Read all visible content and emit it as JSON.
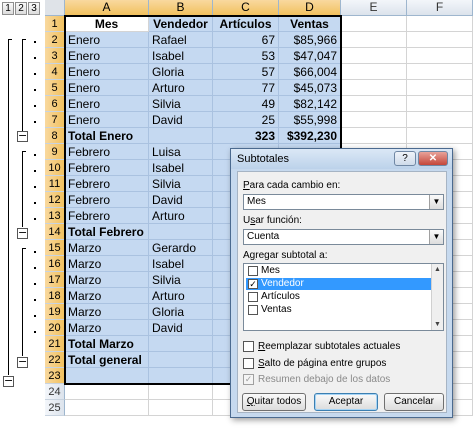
{
  "outline": {
    "levels": [
      "1",
      "2",
      "3"
    ],
    "collapse_glyph": "−"
  },
  "columns": [
    "A",
    "B",
    "C",
    "D",
    "E",
    "F"
  ],
  "rows": [
    "1",
    "2",
    "3",
    "4",
    "5",
    "6",
    "7",
    "8",
    "9",
    "10",
    "11",
    "12",
    "13",
    "14",
    "15",
    "16",
    "17",
    "18",
    "19",
    "20",
    "21",
    "22",
    "23",
    "24",
    "25"
  ],
  "cells": [
    [
      "Mes",
      "Vendedor",
      "Artículos",
      "Ventas"
    ],
    [
      "Enero",
      "Rafael",
      "67",
      "$85,966"
    ],
    [
      "Enero",
      "Isabel",
      "53",
      "$47,047"
    ],
    [
      "Enero",
      "Gloria",
      "57",
      "$66,004"
    ],
    [
      "Enero",
      "Arturo",
      "77",
      "$45,073"
    ],
    [
      "Enero",
      "Silvia",
      "49",
      "$82,142"
    ],
    [
      "Enero",
      "David",
      "25",
      "$55,998"
    ],
    [
      "Total Enero",
      "",
      "323",
      "$392,230"
    ],
    [
      "Febrero",
      "Luisa",
      "",
      ""
    ],
    [
      "Febrero",
      "Isabel",
      "",
      ""
    ],
    [
      "Febrero",
      "Silvia",
      "",
      ""
    ],
    [
      "Febrero",
      "David",
      "",
      ""
    ],
    [
      "Febrero",
      "Arturo",
      "",
      ""
    ],
    [
      "Total Febrero",
      "",
      "",
      ""
    ],
    [
      "Marzo",
      "Gerardo",
      "",
      ""
    ],
    [
      "Marzo",
      "Isabel",
      "",
      ""
    ],
    [
      "Marzo",
      "Silvia",
      "",
      ""
    ],
    [
      "Marzo",
      "Arturo",
      "",
      ""
    ],
    [
      "Marzo",
      "Gloria",
      "",
      ""
    ],
    [
      "Marzo",
      "David",
      "",
      ""
    ],
    [
      "Total Marzo",
      "",
      "",
      ""
    ],
    [
      "Total general",
      "",
      "",
      ""
    ],
    [
      "",
      "",
      "",
      ""
    ],
    [
      "",
      "",
      "",
      ""
    ],
    [
      "",
      "",
      "",
      ""
    ]
  ],
  "dialog": {
    "title": "Subtotales",
    "help": "?",
    "close": "✕",
    "group_by_label_pre": "",
    "group_by_label_u": "P",
    "group_by_label_post": "ara cada cambio en:",
    "group_by_value": "Mes",
    "function_label_pre": "U",
    "function_label_u": "s",
    "function_label_post": "ar función:",
    "function_value": "Cuenta",
    "add_label_pre": "A",
    "add_label_u": "g",
    "add_label_post": "regar subtotal a:",
    "fields": [
      {
        "label": "Mes",
        "checked": false
      },
      {
        "label": "Vendedor",
        "checked": true
      },
      {
        "label": "Artículos",
        "checked": false
      },
      {
        "label": "Ventas",
        "checked": false
      }
    ],
    "check_glyph": "✓",
    "arrow_up": "▲",
    "arrow_down": "▼",
    "replace_pre": "",
    "replace_u": "R",
    "replace_post": "eemplazar subtotales actuales",
    "pagebreak_pre": "",
    "pagebreak_u": "S",
    "pagebreak_post": "alto de página entre grupos",
    "summary_label": "Resumen debajo de los datos",
    "remove_all_pre": "",
    "remove_all_u": "Q",
    "remove_all_post": "uitar todos",
    "ok": "Aceptar",
    "cancel": "Cancelar"
  }
}
